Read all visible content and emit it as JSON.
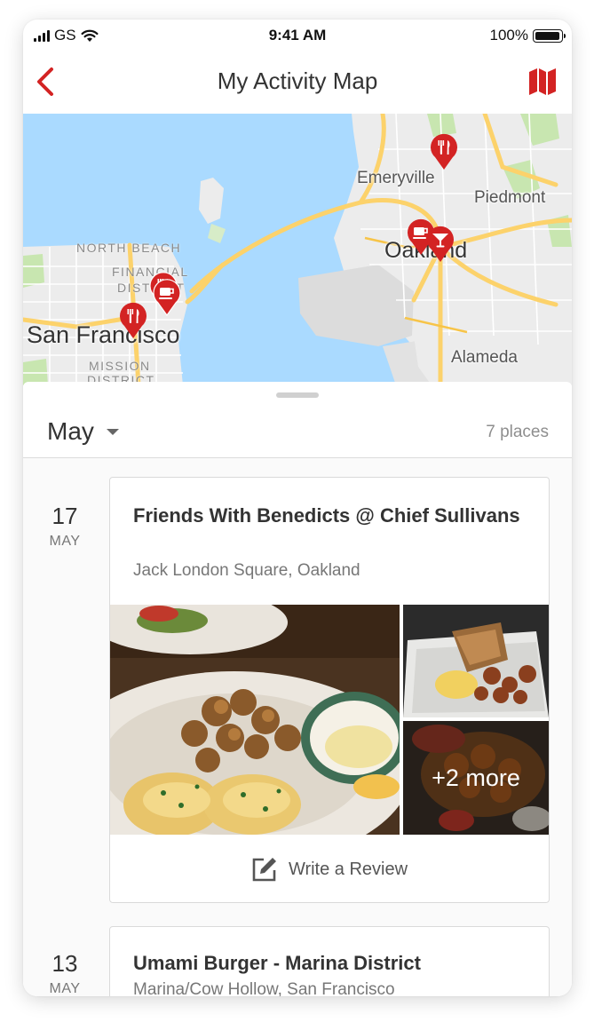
{
  "status_bar": {
    "carrier": "GS",
    "time": "9:41 AM",
    "battery": "100%",
    "battery_level": 1.0
  },
  "nav": {
    "title": "My Activity Map"
  },
  "colors": {
    "accent": "#d32323",
    "water": "#aadaff",
    "land": "#ececec",
    "road": "#fcd26b"
  },
  "map": {
    "labels": {
      "san_francisco": "San Francisco",
      "oakland": "Oakland",
      "emeryville": "Emeryville",
      "piedmont": "Piedmont",
      "alameda": "Alameda",
      "north_beach": "NORTH BEACH",
      "financial": "FINANCIAL",
      "district": "DISTRICT",
      "mission": "MISSION",
      "mission_district": "DISTRICT"
    },
    "pins": [
      "fork-knife-icon",
      "coffee-icon",
      "cocktail-icon"
    ]
  },
  "sheet": {
    "month": "May",
    "place_count": "7 places"
  },
  "entries": [
    {
      "day": "17",
      "month": "MAY",
      "name": "Friends With Benedicts @ Chief Sullivans",
      "location": "Jack London Square, Oakland",
      "more_photos": "+2 more",
      "review_label": "Write a Review"
    },
    {
      "day": "13",
      "month": "MAY",
      "name": "Umami Burger - Marina District",
      "location": "Marina/Cow Hollow, San Francisco"
    }
  ]
}
